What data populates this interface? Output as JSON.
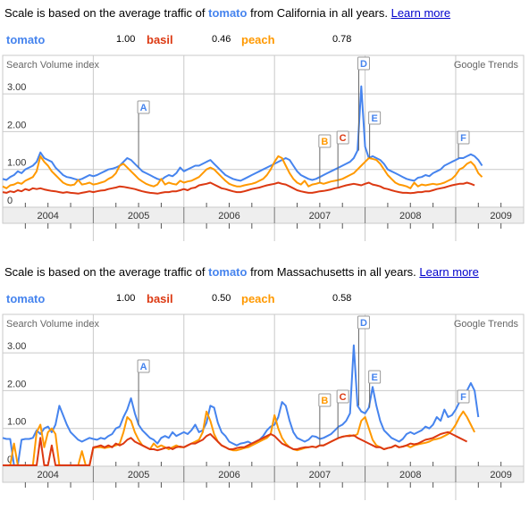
{
  "panels": [
    {
      "scale_prefix": "Scale is based on the average traffic of ",
      "scale_term": "tomato",
      "scale_suffix": " from California in all years. ",
      "learn_more": "Learn more",
      "legend": [
        {
          "name": "tomato",
          "value": "1.00",
          "color": "#4684ee"
        },
        {
          "name": "basil",
          "value": "0.46",
          "color": "#dc3912"
        },
        {
          "name": "peach",
          "value": "0.78",
          "color": "#ff9900"
        }
      ]
    },
    {
      "scale_prefix": "Scale is based on the average traffic of ",
      "scale_term": "tomato",
      "scale_suffix": " from Massachusetts in all years. ",
      "learn_more": "Learn more",
      "legend": [
        {
          "name": "tomato",
          "value": "1.00",
          "color": "#4684ee"
        },
        {
          "name": "basil",
          "value": "0.50",
          "color": "#dc3912"
        },
        {
          "name": "peach",
          "value": "0.58",
          "color": "#ff9900"
        }
      ]
    }
  ],
  "chart_data": [
    {
      "type": "line",
      "title": "Search Volume index",
      "watermark": "Google Trends",
      "region": "California",
      "ylabel": "Search Volume index",
      "ylim": [
        0,
        3.6
      ],
      "yticks": [
        0,
        1,
        2,
        3
      ],
      "ytick_labels": [
        "0",
        "1.00",
        "2.00",
        "3.00"
      ],
      "xlim": [
        2004.0,
        2009.75
      ],
      "xtick_labels": [
        "2004",
        "2005",
        "2006",
        "2007",
        "2008",
        "2009"
      ],
      "grid": true,
      "legend": "top",
      "annotations": [
        {
          "label": "A",
          "x": 2005.5,
          "color": "#4684ee",
          "series": "tomato"
        },
        {
          "label": "B",
          "x": 2007.5,
          "color": "#ff9900",
          "series": "peach"
        },
        {
          "label": "C",
          "x": 2007.7,
          "color": "#dc3912",
          "series": "basil"
        },
        {
          "label": "D",
          "x": 2007.93,
          "color": "#4684ee",
          "series": "tomato"
        },
        {
          "label": "E",
          "x": 2008.05,
          "color": "#4684ee",
          "series": "tomato"
        },
        {
          "label": "F",
          "x": 2009.03,
          "color": "#4684ee",
          "series": "tomato"
        }
      ],
      "x_step": 0.0416667,
      "series": [
        {
          "name": "tomato",
          "color": "#4684ee",
          "values": [
            0.75,
            0.72,
            0.8,
            0.85,
            0.95,
            0.9,
            1.0,
            1.05,
            1.1,
            1.2,
            1.45,
            1.3,
            1.25,
            1.2,
            1.05,
            0.95,
            0.85,
            0.8,
            0.78,
            0.75,
            0.72,
            0.75,
            0.8,
            0.85,
            0.82,
            0.85,
            0.9,
            0.95,
            1.0,
            1.02,
            1.05,
            1.1,
            1.2,
            1.3,
            1.25,
            1.15,
            1.05,
            0.95,
            0.9,
            0.85,
            0.8,
            0.75,
            0.72,
            0.8,
            0.85,
            0.82,
            0.9,
            1.05,
            0.95,
            1.0,
            1.05,
            1.1,
            1.1,
            1.15,
            1.2,
            1.25,
            1.15,
            1.05,
            0.95,
            0.85,
            0.8,
            0.75,
            0.72,
            0.7,
            0.75,
            0.8,
            0.85,
            0.9,
            0.95,
            1.0,
            1.05,
            1.1,
            1.15,
            1.2,
            1.25,
            1.3,
            1.25,
            1.1,
            0.95,
            0.85,
            0.8,
            0.75,
            0.72,
            0.75,
            0.8,
            0.85,
            0.9,
            0.95,
            1.0,
            1.05,
            1.1,
            1.15,
            1.2,
            1.3,
            1.5,
            3.2,
            1.6,
            1.3,
            1.35,
            1.3,
            1.25,
            1.15,
            1.0,
            0.95,
            0.9,
            0.85,
            0.8,
            0.75,
            0.72,
            0.7,
            0.78,
            0.8,
            0.85,
            0.82,
            0.9,
            0.95,
            1.0,
            1.1,
            1.15,
            1.2,
            1.25,
            1.3,
            1.3,
            1.35,
            1.4,
            1.35,
            1.25,
            1.1
          ]
        },
        {
          "name": "basil",
          "color": "#dc3912",
          "values": [
            0.4,
            0.38,
            0.42,
            0.4,
            0.45,
            0.42,
            0.48,
            0.45,
            0.5,
            0.48,
            0.5,
            0.47,
            0.45,
            0.43,
            0.42,
            0.4,
            0.38,
            0.4,
            0.38,
            0.37,
            0.36,
            0.38,
            0.4,
            0.42,
            0.4,
            0.42,
            0.44,
            0.45,
            0.48,
            0.5,
            0.52,
            0.55,
            0.54,
            0.52,
            0.5,
            0.48,
            0.45,
            0.42,
            0.4,
            0.38,
            0.37,
            0.36,
            0.38,
            0.4,
            0.4,
            0.42,
            0.42,
            0.45,
            0.48,
            0.45,
            0.5,
            0.52,
            0.58,
            0.6,
            0.62,
            0.65,
            0.6,
            0.55,
            0.5,
            0.48,
            0.45,
            0.42,
            0.4,
            0.4,
            0.42,
            0.45,
            0.48,
            0.5,
            0.52,
            0.55,
            0.58,
            0.6,
            0.62,
            0.65,
            0.62,
            0.6,
            0.55,
            0.5,
            0.45,
            0.42,
            0.4,
            0.38,
            0.38,
            0.4,
            0.42,
            0.43,
            0.45,
            0.47,
            0.5,
            0.52,
            0.55,
            0.58,
            0.6,
            0.62,
            0.6,
            0.58,
            0.62,
            0.65,
            0.6,
            0.58,
            0.55,
            0.5,
            0.48,
            0.45,
            0.42,
            0.4,
            0.38,
            0.38,
            0.37,
            0.38,
            0.4,
            0.4,
            0.42,
            0.42,
            0.45,
            0.48,
            0.5,
            0.52,
            0.55,
            0.58,
            0.6,
            0.62,
            0.62,
            0.65,
            0.62,
            0.58
          ]
        },
        {
          "name": "peach",
          "color": "#ff9900",
          "values": [
            0.55,
            0.5,
            0.58,
            0.6,
            0.65,
            0.62,
            0.7,
            0.75,
            0.8,
            0.95,
            1.35,
            1.2,
            1.1,
            0.95,
            0.85,
            0.75,
            0.65,
            0.6,
            0.58,
            0.6,
            0.72,
            0.6,
            0.62,
            0.65,
            0.6,
            0.62,
            0.65,
            0.68,
            0.75,
            0.8,
            0.9,
            1.1,
            1.15,
            1.05,
            0.95,
            0.85,
            0.75,
            0.68,
            0.62,
            0.58,
            0.55,
            0.6,
            0.75,
            0.6,
            0.65,
            0.62,
            0.6,
            0.7,
            0.65,
            0.68,
            0.7,
            0.75,
            0.8,
            0.9,
            1.0,
            1.05,
            1.0,
            0.9,
            0.8,
            0.7,
            0.62,
            0.58,
            0.55,
            0.55,
            0.58,
            0.6,
            0.62,
            0.65,
            0.7,
            0.75,
            0.85,
            1.0,
            1.2,
            1.35,
            1.3,
            1.1,
            0.9,
            0.75,
            0.65,
            0.6,
            0.7,
            0.55,
            0.6,
            0.62,
            0.65,
            0.62,
            0.65,
            0.68,
            0.7,
            0.72,
            0.75,
            0.8,
            0.85,
            0.9,
            1.0,
            1.1,
            1.2,
            1.3,
            1.28,
            1.25,
            1.15,
            1.0,
            0.85,
            0.75,
            0.65,
            0.6,
            0.58,
            0.55,
            0.5,
            0.65,
            0.55,
            0.6,
            0.58,
            0.6,
            0.62,
            0.6,
            0.62,
            0.65,
            0.7,
            0.75,
            0.85,
            1.0,
            1.05,
            1.15,
            1.2,
            1.1,
            0.9,
            0.8
          ]
        }
      ]
    },
    {
      "type": "line",
      "title": "Search Volume index",
      "watermark": "Google Trends",
      "region": "Massachusetts",
      "ylabel": "Search Volume index",
      "ylim": [
        0,
        3.6
      ],
      "yticks": [
        0,
        1,
        2,
        3
      ],
      "ytick_labels": [
        "0",
        "1.00",
        "2.00",
        "3.00"
      ],
      "xlim": [
        2004.0,
        2009.75
      ],
      "xtick_labels": [
        "2004",
        "2005",
        "2006",
        "2007",
        "2008",
        "2009"
      ],
      "grid": true,
      "legend": "top",
      "annotations": [
        {
          "label": "A",
          "x": 2005.5,
          "color": "#4684ee",
          "series": "tomato"
        },
        {
          "label": "B",
          "x": 2007.5,
          "color": "#ff9900",
          "series": "peach"
        },
        {
          "label": "C",
          "x": 2007.7,
          "color": "#dc3912",
          "series": "basil"
        },
        {
          "label": "D",
          "x": 2007.93,
          "color": "#4684ee",
          "series": "tomato"
        },
        {
          "label": "E",
          "x": 2008.05,
          "color": "#4684ee",
          "series": "tomato"
        },
        {
          "label": "F",
          "x": 2009.03,
          "color": "#4684ee",
          "series": "tomato"
        }
      ],
      "x_step": 0.0416667,
      "series": [
        {
          "name": "tomato",
          "color": "#4684ee",
          "values": [
            0.75,
            0.72,
            0.72,
            0.0,
            0.0,
            0.7,
            0.72,
            0.72,
            0.75,
            0.95,
            0.85,
            1.0,
            1.05,
            0.9,
            1.1,
            1.6,
            1.35,
            1.1,
            0.9,
            0.8,
            0.7,
            0.65,
            0.7,
            0.75,
            0.72,
            0.7,
            0.75,
            0.72,
            0.8,
            0.85,
            1.0,
            1.05,
            1.3,
            1.5,
            1.8,
            1.4,
            1.1,
            0.95,
            0.85,
            0.75,
            0.7,
            0.6,
            0.75,
            0.8,
            0.75,
            0.9,
            0.8,
            0.85,
            0.9,
            0.85,
            0.95,
            1.1,
            0.9,
            0.95,
            1.15,
            1.6,
            1.55,
            1.15,
            0.9,
            0.8,
            0.65,
            0.6,
            0.55,
            0.6,
            0.62,
            0.65,
            0.6,
            0.65,
            0.7,
            0.8,
            0.95,
            1.05,
            1.1,
            1.3,
            1.7,
            1.6,
            1.2,
            0.9,
            0.75,
            0.7,
            0.65,
            0.7,
            0.8,
            0.78,
            0.72,
            0.75,
            0.8,
            0.85,
            0.95,
            1.05,
            1.1,
            1.2,
            1.4,
            3.2,
            1.6,
            1.45,
            1.4,
            1.55,
            2.1,
            1.6,
            1.2,
            0.95,
            0.85,
            0.75,
            0.7,
            0.65,
            0.72,
            0.85,
            0.9,
            0.85,
            0.9,
            0.95,
            1.05,
            1.0,
            1.1,
            1.3,
            1.2,
            1.5,
            1.3,
            1.35,
            1.5,
            1.7,
            1.85,
            2.0,
            2.2,
            2.0,
            1.3
          ]
        },
        {
          "name": "basil",
          "color": "#dc3912",
          "values": [
            0.0,
            0.0,
            0.0,
            0.0,
            0.0,
            0.0,
            0.0,
            0.0,
            0.0,
            0.0,
            0.75,
            0.0,
            0.0,
            0.55,
            0.0,
            0.0,
            0.0,
            0.0,
            0.0,
            0.0,
            0.0,
            0.0,
            0.0,
            0.0,
            0.5,
            0.52,
            0.55,
            0.5,
            0.55,
            0.5,
            0.6,
            0.55,
            0.6,
            0.7,
            0.75,
            0.65,
            0.6,
            0.55,
            0.5,
            0.45,
            0.45,
            0.42,
            0.45,
            0.48,
            0.5,
            0.45,
            0.5,
            0.52,
            0.5,
            0.55,
            0.6,
            0.6,
            0.65,
            0.7,
            0.8,
            0.85,
            0.75,
            0.65,
            0.55,
            0.5,
            0.45,
            0.45,
            0.48,
            0.5,
            0.5,
            0.55,
            0.6,
            0.65,
            0.7,
            0.75,
            0.8,
            0.85,
            0.8,
            0.7,
            0.6,
            0.55,
            0.5,
            0.45,
            0.45,
            0.48,
            0.5,
            0.5,
            0.52,
            0.5,
            0.55,
            0.55,
            0.6,
            0.65,
            0.7,
            0.75,
            0.78,
            0.8,
            0.8,
            0.82,
            0.75,
            0.7,
            0.65,
            0.6,
            0.55,
            0.5,
            0.5,
            0.45,
            0.48,
            0.5,
            0.55,
            0.5,
            0.52,
            0.55,
            0.6,
            0.58,
            0.6,
            0.65,
            0.7,
            0.72,
            0.75,
            0.8,
            0.85,
            0.88,
            0.9,
            0.85,
            0.8,
            0.75,
            0.7,
            0.65
          ]
        },
        {
          "name": "peach",
          "color": "#ff9900",
          "values": [
            0.0,
            0.0,
            0.0,
            0.6,
            0.0,
            0.0,
            0.0,
            0.0,
            0.0,
            0.9,
            1.1,
            0.5,
            0.9,
            1.0,
            0.85,
            0.0,
            0.0,
            0.0,
            0.0,
            0.0,
            0.0,
            0.4,
            0.0,
            0.0,
            0.48,
            0.5,
            0.5,
            0.48,
            0.5,
            0.52,
            0.55,
            0.6,
            0.9,
            1.3,
            1.2,
            0.9,
            0.7,
            0.55,
            0.5,
            0.45,
            0.6,
            0.5,
            0.55,
            0.5,
            0.45,
            0.5,
            0.55,
            0.5,
            0.5,
            0.55,
            0.6,
            0.65,
            0.7,
            0.9,
            1.45,
            1.2,
            0.85,
            0.65,
            0.55,
            0.5,
            0.45,
            0.42,
            0.42,
            0.45,
            0.48,
            0.5,
            0.55,
            0.6,
            0.65,
            0.7,
            0.75,
            0.85,
            1.35,
            1.0,
            0.75,
            0.6,
            0.5,
            0.45,
            0.42,
            0.45,
            0.48,
            0.5,
            0.52,
            0.5,
            0.55,
            0.55,
            0.6,
            0.65,
            0.7,
            0.75,
            0.78,
            0.8,
            0.82,
            0.8,
            0.85,
            1.2,
            1.3,
            1.0,
            0.7,
            0.55,
            0.5,
            0.45,
            0.48,
            0.5,
            0.55,
            0.5,
            0.52,
            0.55,
            0.5,
            0.55,
            0.58,
            0.6,
            0.62,
            0.65,
            0.7,
            0.72,
            0.75,
            0.8,
            0.85,
            0.95,
            1.1,
            1.3,
            1.45,
            1.3,
            1.1,
            0.9
          ]
        }
      ]
    }
  ]
}
